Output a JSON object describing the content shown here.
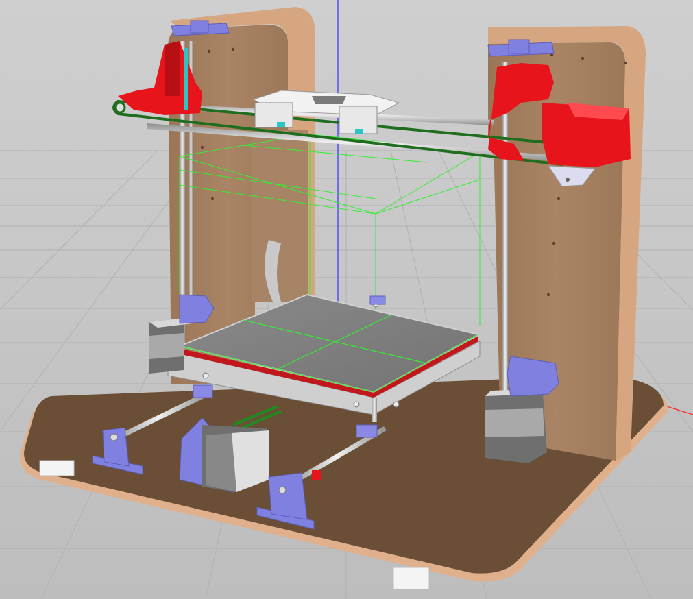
{
  "viewport": {
    "kind": "3d-cad-viewport",
    "model": "cartesian-3d-printer",
    "background_color": "#c9c9c9",
    "grid_color": "#b3b3b3"
  },
  "colors": {
    "frame_wood": "#a47f5f",
    "frame_wood_dark": "#6f5238",
    "printed_red": "#e8141b",
    "printed_blue": "#8080e0",
    "motor_gray": "#6f6f6f",
    "motor_light": "#d9d9d9",
    "rod_gray": "#c4c4c4",
    "bed_surface": "#7f7f7f",
    "belt_green": "#1f6e1f",
    "build_volume_green": "#33ee33",
    "axis_blue": "#3333ff",
    "axis_red": "#ff2222"
  },
  "parts": [
    {
      "name": "base-plate",
      "icon": "base-plate-icon"
    },
    {
      "name": "back-frame",
      "icon": "frame-icon"
    },
    {
      "name": "x-axis-gantry",
      "icon": "gantry-icon"
    },
    {
      "name": "print-head-carriage",
      "icon": "carriage-icon"
    },
    {
      "name": "heated-bed",
      "icon": "bed-icon"
    },
    {
      "name": "build-volume",
      "icon": "bounding-box-icon"
    },
    {
      "name": "z-motor-left",
      "icon": "stepper-motor-icon"
    },
    {
      "name": "z-motor-right",
      "icon": "stepper-motor-icon"
    },
    {
      "name": "y-motor",
      "icon": "stepper-motor-icon"
    },
    {
      "name": "x-motor-mount",
      "icon": "motor-mount-icon"
    }
  ]
}
